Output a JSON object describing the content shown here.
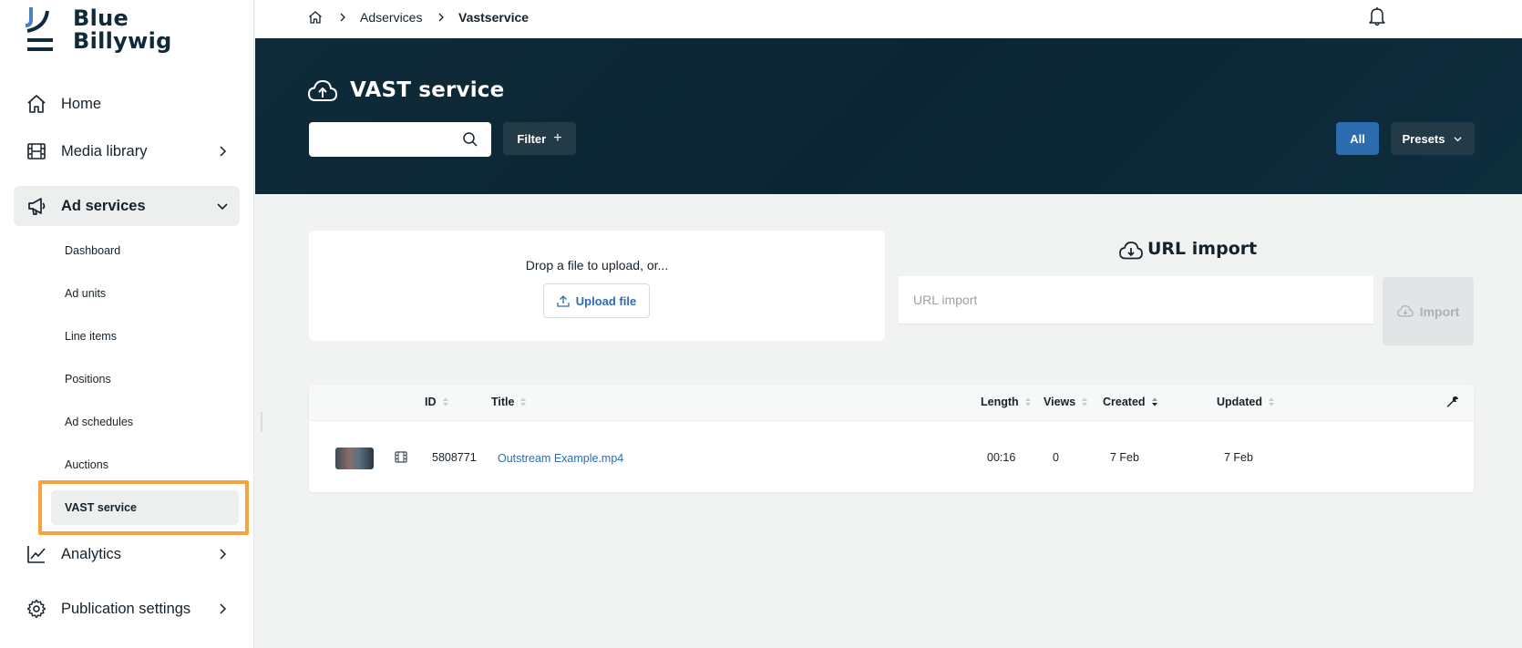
{
  "brand": {
    "line1": "Blue",
    "line2": "Billywig"
  },
  "sidebar": {
    "items": [
      {
        "label": "Home",
        "icon": "home-icon"
      },
      {
        "label": "Media library",
        "icon": "film-icon"
      },
      {
        "label": "Ad services",
        "icon": "megaphone-icon"
      },
      {
        "label": "Analytics",
        "icon": "chart-line-icon"
      },
      {
        "label": "Publication settings",
        "icon": "gear-icon"
      }
    ],
    "subitems": [
      "Dashboard",
      "Ad units",
      "Line items",
      "Positions",
      "Ad schedules",
      "Auctions",
      "VAST service"
    ]
  },
  "breadcrumb": {
    "items": [
      "Adservices",
      "Vastservice"
    ]
  },
  "header": {
    "title": "VAST service",
    "search_placeholder": "",
    "filter_label": "Filter",
    "all_label": "All",
    "presets_label": "Presets"
  },
  "upload": {
    "prompt": "Drop a file to upload, or...",
    "button_label": "Upload file"
  },
  "url_import": {
    "title": "URL import",
    "placeholder": "URL import",
    "button_label": "Import"
  },
  "table": {
    "columns": [
      "ID",
      "Title",
      "Length",
      "Views",
      "Created",
      "Updated"
    ],
    "rows": [
      {
        "id": "5808771",
        "title": "Outstream Example.mp4",
        "length": "00:16",
        "views": "0",
        "created": "7 Feb",
        "updated": "7 Feb"
      }
    ]
  },
  "colors": {
    "accent": "#2c6db1",
    "hero": "#0f2a38",
    "highlight": "#f5a33b"
  }
}
